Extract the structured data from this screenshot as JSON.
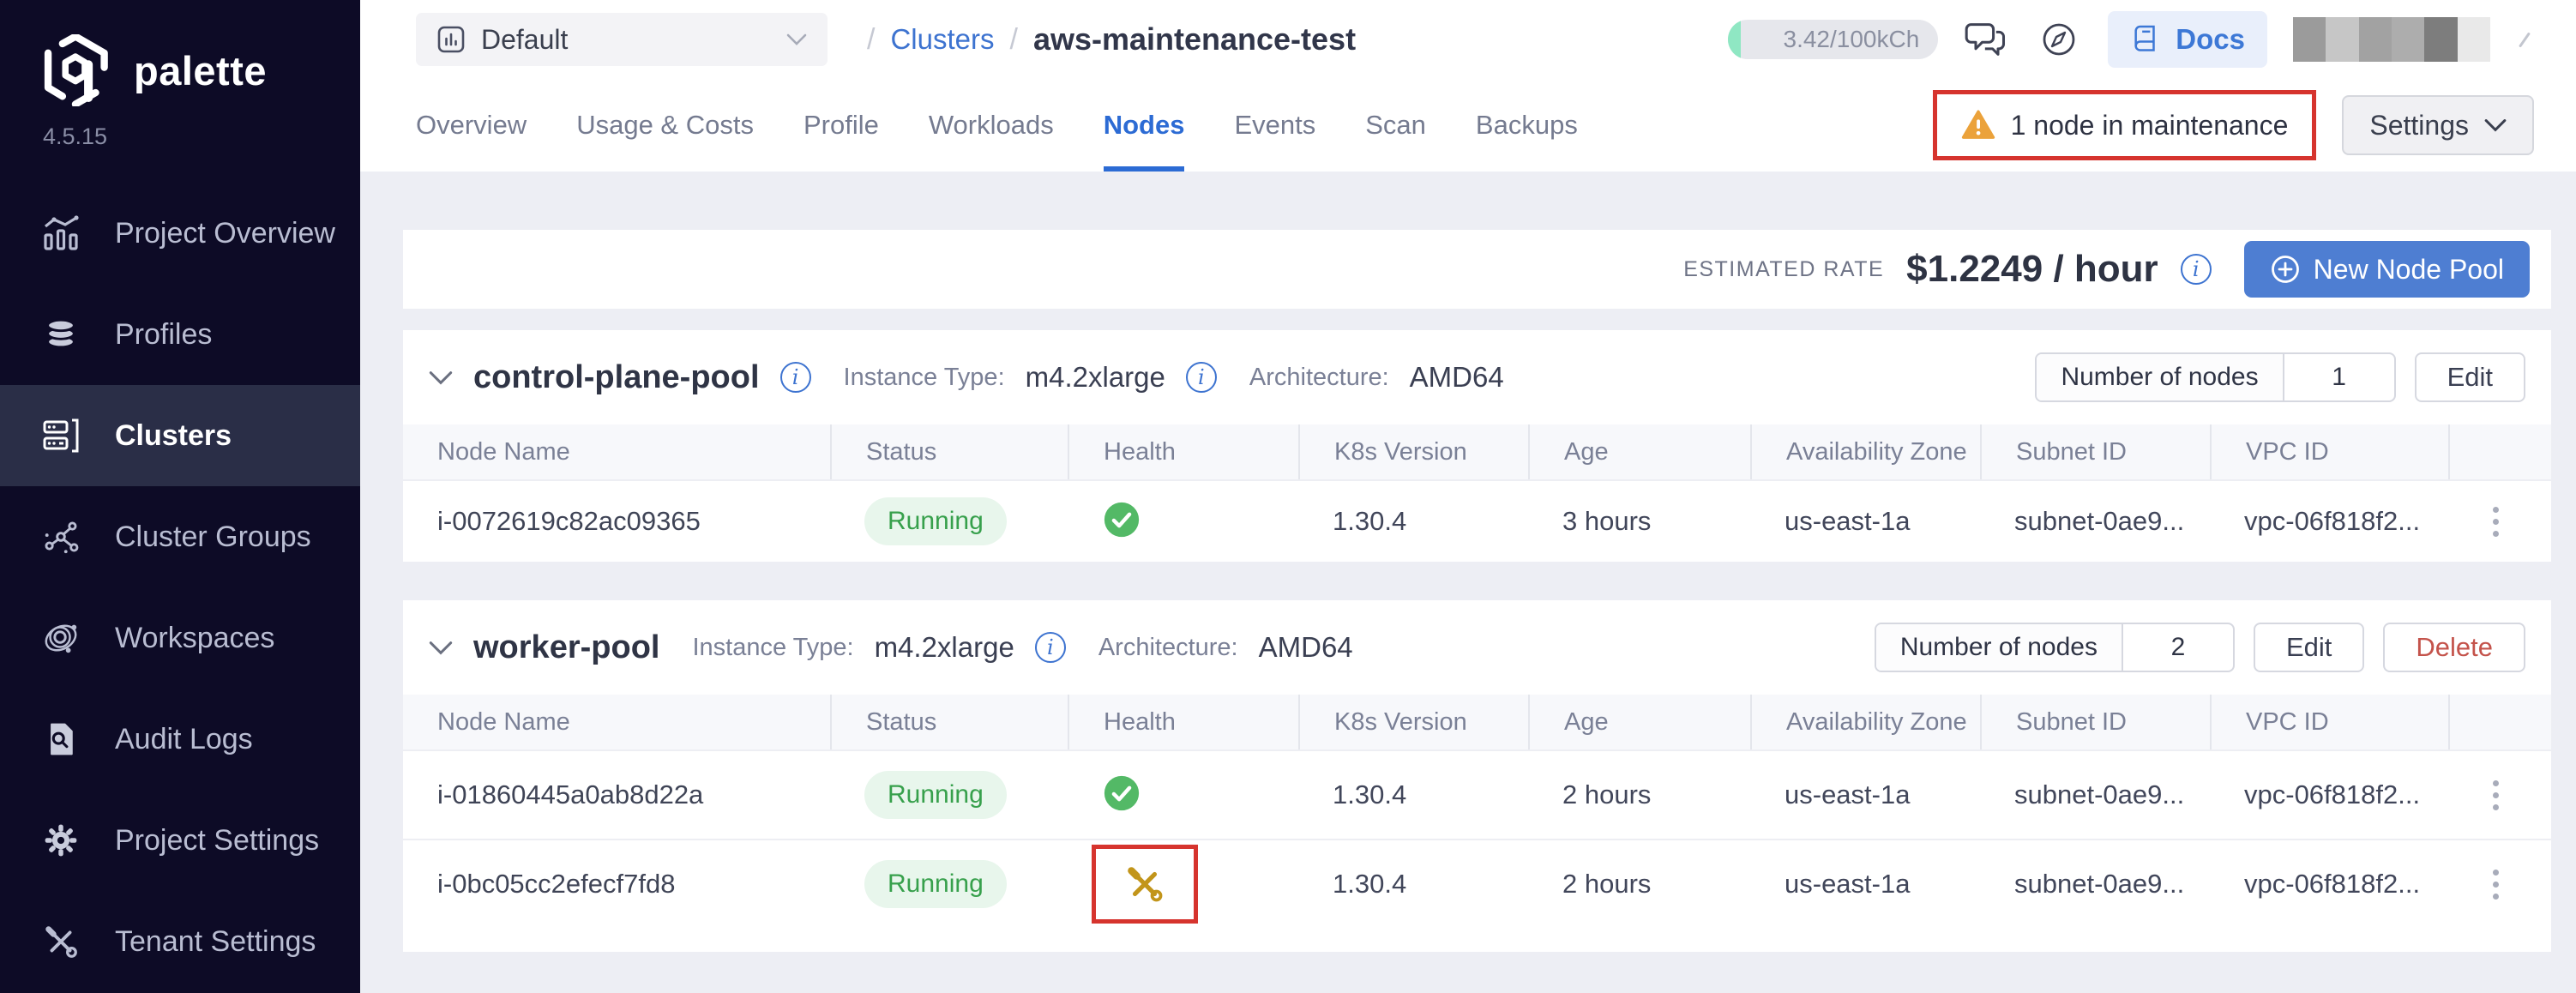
{
  "brand": {
    "name": "palette",
    "version": "4.5.15"
  },
  "sidebar": {
    "items": [
      {
        "label": "Project Overview"
      },
      {
        "label": "Profiles"
      },
      {
        "label": "Clusters"
      },
      {
        "label": "Cluster Groups"
      },
      {
        "label": "Workspaces"
      },
      {
        "label": "Audit Logs"
      },
      {
        "label": "Project Settings"
      },
      {
        "label": "Tenant Settings"
      }
    ],
    "active_item": "Clusters"
  },
  "topbar": {
    "project": "Default",
    "breadcrumb_separator": "/",
    "breadcrumb_section": "Clusters",
    "breadcrumb_current": "aws-maintenance-test",
    "usage_badge": "3.42/100kCh",
    "docs": "Docs"
  },
  "tabs": {
    "items": [
      {
        "label": "Overview"
      },
      {
        "label": "Usage & Costs"
      },
      {
        "label": "Profile"
      },
      {
        "label": "Workloads"
      },
      {
        "label": "Nodes"
      },
      {
        "label": "Events"
      },
      {
        "label": "Scan"
      },
      {
        "label": "Backups"
      }
    ],
    "active": "Nodes"
  },
  "header_actions": {
    "maintenance_warning": "1 node in maintenance",
    "settings": "Settings"
  },
  "rate_bar": {
    "label": "ESTIMATED RATE",
    "value": "$1.2249 / hour",
    "new_node_pool": "New Node Pool"
  },
  "table_columns": [
    "Node Name",
    "Status",
    "Health",
    "K8s Version",
    "Age",
    "Availability Zone",
    "Subnet ID",
    "VPC ID"
  ],
  "pools": [
    {
      "name": "control-plane-pool",
      "instance_type_label": "Instance Type:",
      "instance_type": "m4.2xlarge",
      "architecture_label": "Architecture:",
      "architecture": "AMD64",
      "nodes_count_label": "Number of nodes",
      "nodes_count": "1",
      "edit": "Edit",
      "nodes": [
        {
          "name": "i-0072619c82ac09365",
          "status": "Running",
          "health": "healthy",
          "k8s_version": "1.30.4",
          "age": "3 hours",
          "availability_zone": "us-east-1a",
          "subnet_id": "subnet-0ae9...",
          "vpc_id": "vpc-06f818f2..."
        }
      ]
    },
    {
      "name": "worker-pool",
      "instance_type_label": "Instance Type:",
      "instance_type": "m4.2xlarge",
      "architecture_label": "Architecture:",
      "architecture": "AMD64",
      "nodes_count_label": "Number of nodes",
      "nodes_count": "2",
      "edit": "Edit",
      "delete": "Delete",
      "nodes": [
        {
          "name": "i-01860445a0ab8d22a",
          "status": "Running",
          "health": "healthy",
          "k8s_version": "1.30.4",
          "age": "2 hours",
          "availability_zone": "us-east-1a",
          "subnet_id": "subnet-0ae9...",
          "vpc_id": "vpc-06f818f2..."
        },
        {
          "name": "i-0bc05cc2efecf7fd8",
          "status": "Running",
          "health": "maintenance",
          "k8s_version": "1.30.4",
          "age": "2 hours",
          "availability_zone": "us-east-1a",
          "subnet_id": "subnet-0ae9...",
          "vpc_id": "vpc-06f818f2..."
        }
      ]
    }
  ],
  "colors": {
    "accent_blue": "#2C6BD4",
    "button_blue": "#4E7ED2",
    "success_green": "#37A04C",
    "maintenance_gold": "#C2951A",
    "warning_orange": "#EBA23B",
    "annotation_red": "#D6342E",
    "sidebar_bg": "#0D0B26"
  }
}
